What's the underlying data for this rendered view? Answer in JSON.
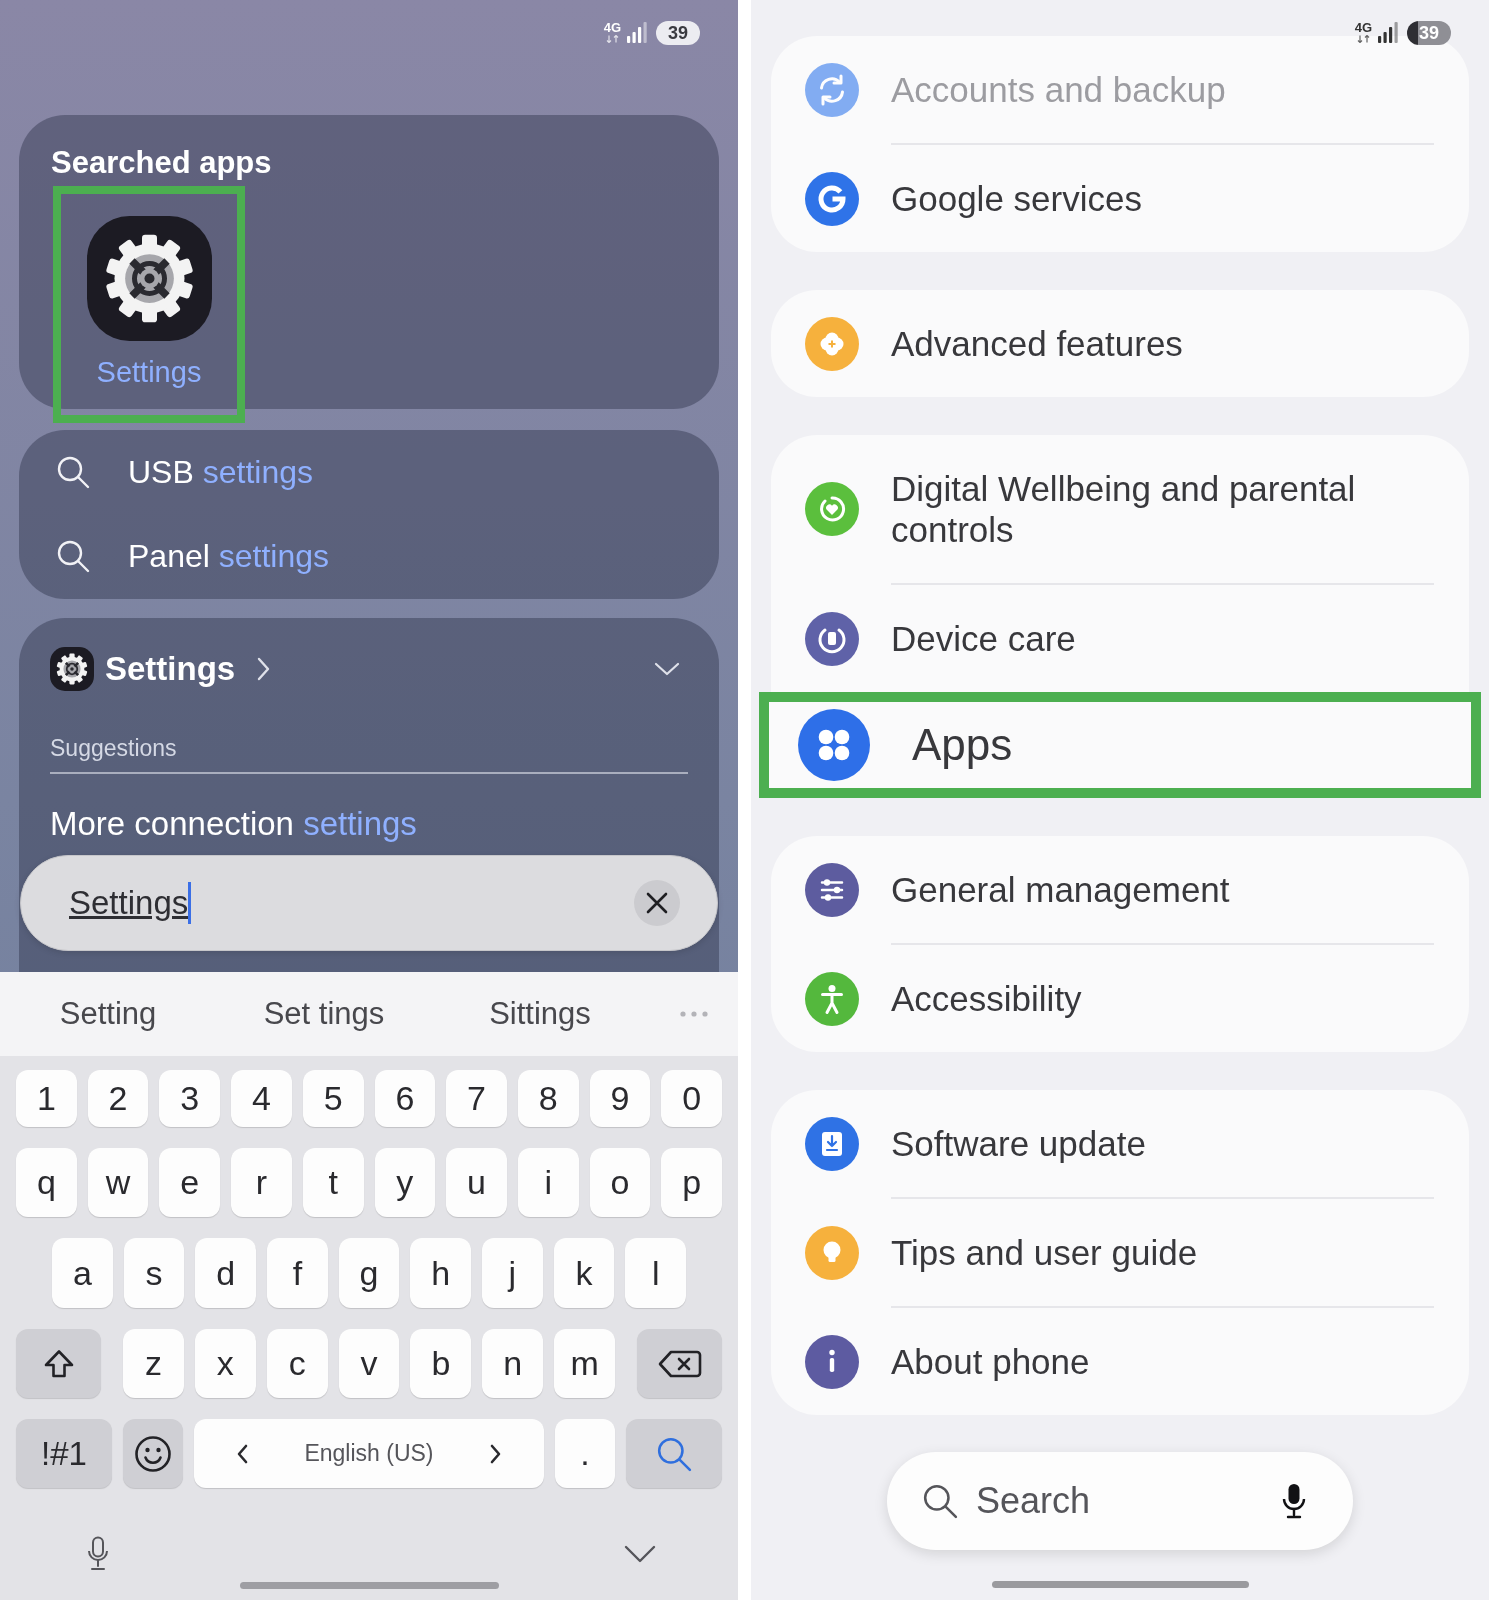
{
  "search_screen": {
    "status_bar": {
      "network": "4G",
      "battery": "39"
    },
    "searched_apps": {
      "title": "Searched apps",
      "apps": [
        {
          "label": "Settings",
          "highlighted": true
        }
      ]
    },
    "suggestions": [
      {
        "parts": [
          {
            "text": "USB ",
            "match": false
          },
          {
            "text": "settings",
            "match": true
          }
        ]
      },
      {
        "parts": [
          {
            "text": "Panel ",
            "match": false
          },
          {
            "text": "settings",
            "match": true
          }
        ]
      }
    ],
    "app_results": {
      "app": "Settings",
      "section": "Suggestions",
      "items": [
        {
          "parts": [
            {
              "text": "More connection ",
              "match": false
            },
            {
              "text": "settings",
              "match": true
            }
          ]
        }
      ]
    },
    "search_field": {
      "value": "Settings"
    },
    "keyboard": {
      "predictions": [
        "Setting",
        "Set tings",
        "Sittings"
      ],
      "rows": [
        {
          "keys": [
            {
              "kind": "char",
              "label": "1"
            },
            {
              "kind": "char",
              "label": "2"
            },
            {
              "kind": "char",
              "label": "3"
            },
            {
              "kind": "char",
              "label": "4"
            },
            {
              "kind": "char",
              "label": "5"
            },
            {
              "kind": "char",
              "label": "6"
            },
            {
              "kind": "char",
              "label": "7"
            },
            {
              "kind": "char",
              "label": "8"
            },
            {
              "kind": "char",
              "label": "9"
            },
            {
              "kind": "char",
              "label": "0"
            }
          ]
        },
        {
          "keys": [
            {
              "kind": "char",
              "label": "q"
            },
            {
              "kind": "char",
              "label": "w"
            },
            {
              "kind": "char",
              "label": "e"
            },
            {
              "kind": "char",
              "label": "r"
            },
            {
              "kind": "char",
              "label": "t"
            },
            {
              "kind": "char",
              "label": "y"
            },
            {
              "kind": "char",
              "label": "u"
            },
            {
              "kind": "char",
              "label": "i"
            },
            {
              "kind": "char",
              "label": "o"
            },
            {
              "kind": "char",
              "label": "p"
            }
          ]
        },
        {
          "keys": [
            {
              "kind": "char",
              "label": "a"
            },
            {
              "kind": "char",
              "label": "s"
            },
            {
              "kind": "char",
              "label": "d"
            },
            {
              "kind": "char",
              "label": "f"
            },
            {
              "kind": "char",
              "label": "g"
            },
            {
              "kind": "char",
              "label": "h"
            },
            {
              "kind": "char",
              "label": "j"
            },
            {
              "kind": "char",
              "label": "k"
            },
            {
              "kind": "char",
              "label": "l"
            }
          ]
        },
        {
          "keys": [
            {
              "kind": "shift"
            },
            {
              "kind": "char",
              "label": "z"
            },
            {
              "kind": "char",
              "label": "x"
            },
            {
              "kind": "char",
              "label": "c"
            },
            {
              "kind": "char",
              "label": "v"
            },
            {
              "kind": "char",
              "label": "b"
            },
            {
              "kind": "char",
              "label": "n"
            },
            {
              "kind": "char",
              "label": "m"
            },
            {
              "kind": "backspace"
            }
          ]
        },
        {
          "keys": [
            {
              "kind": "symbols",
              "label": "!#1"
            },
            {
              "kind": "emoji"
            },
            {
              "kind": "space",
              "label": "English (US)"
            },
            {
              "kind": "char",
              "label": "."
            },
            {
              "kind": "search"
            }
          ]
        }
      ]
    }
  },
  "settings_screen": {
    "status_bar": {
      "network": "4G",
      "battery": "39"
    },
    "groups": [
      {
        "items": [
          {
            "label": "Accounts and backup",
            "dimmed": true,
            "highlighted": false
          },
          {
            "label": "Google services",
            "dimmed": false,
            "highlighted": false
          }
        ]
      },
      {
        "items": [
          {
            "label": "Advanced features",
            "dimmed": false,
            "highlighted": false
          }
        ]
      },
      {
        "items": [
          {
            "label": "Digital Wellbeing and parental controls",
            "dimmed": false,
            "highlighted": false
          },
          {
            "label": "Device care",
            "dimmed": false,
            "highlighted": false
          },
          {
            "label": "Apps",
            "dimmed": false,
            "highlighted": true
          }
        ]
      },
      {
        "items": [
          {
            "label": "General management",
            "dimmed": false,
            "highlighted": false
          },
          {
            "label": "Accessibility",
            "dimmed": false,
            "highlighted": false
          }
        ]
      },
      {
        "items": [
          {
            "label": "Software update",
            "dimmed": false,
            "highlighted": false
          },
          {
            "label": "Tips and user guide",
            "dimmed": false,
            "highlighted": false
          },
          {
            "label": "About phone",
            "dimmed": false,
            "highlighted": false
          }
        ]
      }
    ],
    "search": {
      "placeholder": "Search"
    }
  }
}
